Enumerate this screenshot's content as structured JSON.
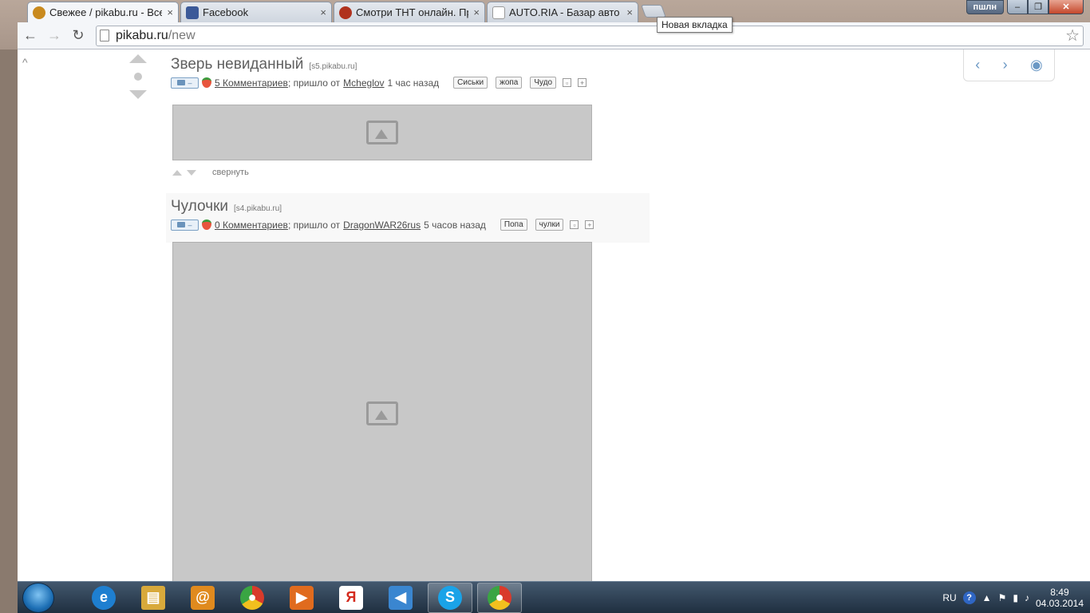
{
  "browser": {
    "tabs": [
      {
        "title": "Свежее / pikabu.ru - Все",
        "favicon_color": "#c98a1e",
        "active": true
      },
      {
        "title": "Facebook",
        "favicon_color": "#3b5998",
        "active": false
      },
      {
        "title": "Смотри ТНТ онлайн. Пр",
        "favicon_color": "#b0321e",
        "active": false
      },
      {
        "title": "AUTO.RIA - Базар авто №",
        "favicon_color": "#cfcfcf",
        "active": false
      }
    ],
    "close_glyph": "×",
    "new_tab_tooltip": "Новая вкладка",
    "user_badge": "пшлн",
    "url_host": "pikabu.ru",
    "url_path": "/new",
    "back_glyph": "←",
    "forward_glyph": "→",
    "reload_glyph": "↻",
    "star_glyph": "☆",
    "window_minimize": "–",
    "window_restore": "❐",
    "window_close": "✕"
  },
  "page": {
    "scroll_up_glyph": "^",
    "side_nav": {
      "prev": "‹",
      "next": "›",
      "eye": "◉"
    },
    "posts": [
      {
        "title": "Зверь невиданный",
        "source": "[s5.pikabu.ru]",
        "cam_dash": "–",
        "comments": "5 Комментариев",
        "via": "; пришло от",
        "author": "Mcheglov",
        "time": "1 час назад",
        "tags": [
          "Сиськи",
          "жопа",
          "Чудо"
        ],
        "collapse": "свернуть"
      },
      {
        "title": "Чулочки",
        "source": "[s4.pikabu.ru]",
        "cam_dash": "–",
        "comments": "0 Комментариев",
        "via": "; пришло от",
        "author": "DragonWAR26rus",
        "time": "5 часов назад",
        "tags": [
          "Попа",
          "чулки"
        ]
      }
    ]
  },
  "taskbar": {
    "language": "RU",
    "help": "?",
    "time": "8:49",
    "date": "04.03.2014",
    "apps": [
      {
        "name": "ie",
        "glyph": "e",
        "color": "#1e7fd0"
      },
      {
        "name": "explorer",
        "glyph": "▤",
        "color": "#d8a93b"
      },
      {
        "name": "mail",
        "glyph": "@",
        "color": "#e08a1e"
      },
      {
        "name": "chrome",
        "glyph": "●",
        "color": "#3aa543"
      },
      {
        "name": "media-player",
        "glyph": "▶",
        "color": "#e06b1e"
      },
      {
        "name": "yandex",
        "glyph": "Я",
        "color": "#d42a1e"
      },
      {
        "name": "audio",
        "glyph": "◀",
        "color": "#3a86d0"
      },
      {
        "name": "skype",
        "glyph": "S",
        "color": "#1aa3e8"
      },
      {
        "name": "chrome-active",
        "glyph": "●",
        "color": "#3aa543"
      }
    ]
  }
}
